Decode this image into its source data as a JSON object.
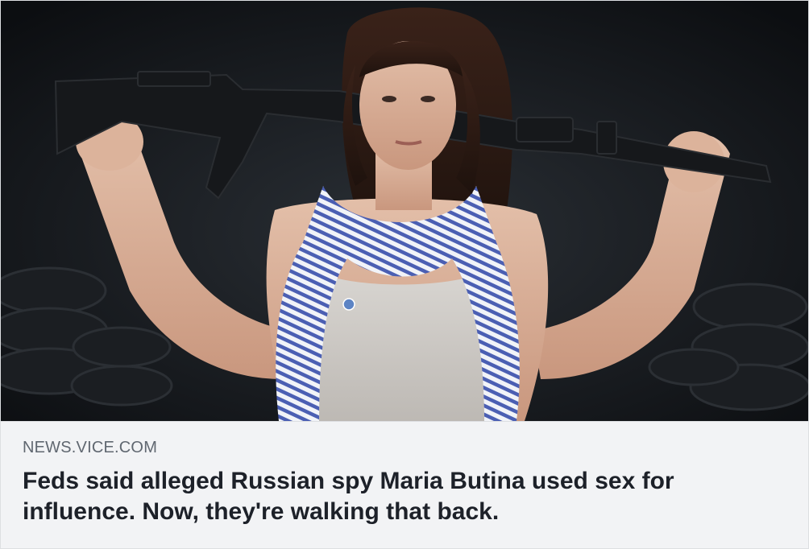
{
  "link_preview": {
    "image_alt": "",
    "domain": "NEWS.VICE.COM",
    "headline": "Feds said alleged Russian spy Maria Butina used sex for influence. Now, they're walking that back."
  },
  "colors": {
    "caption_background": "#f2f3f5",
    "domain_text": "#606770",
    "headline_text": "#1d2129",
    "border": "#dddfe2"
  }
}
